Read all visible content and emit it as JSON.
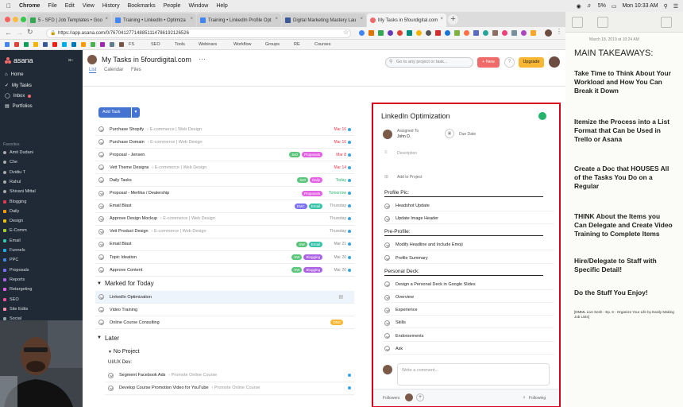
{
  "menubar": {
    "apple": "",
    "app": "Chrome",
    "items": [
      "File",
      "Edit",
      "View",
      "History",
      "Bookmarks",
      "People",
      "Window",
      "Help"
    ],
    "right": [
      "5%",
      "Mon 10:33 AM"
    ]
  },
  "tabs": [
    {
      "label": "5 - SFD | Job Templates • Goo",
      "color": "#34a853"
    },
    {
      "label": "Training • LinkedIn • Optimiza",
      "color": "#4285f4"
    },
    {
      "label": "Training • LinkedIn Profile Opt",
      "color": "#4285f4"
    },
    {
      "label": "Digital Marketing Mastery Lau",
      "color": "#3b5998"
    },
    {
      "label": "My Tasks in 5fourdigital.com",
      "color": "#f06a6a"
    }
  ],
  "address": {
    "url": "https://app.asana.com/0/767041277148851114786192126526"
  },
  "bookmarks": [
    "FS",
    "SEO",
    "Tools",
    "Webinars",
    "Workflow",
    "Groups",
    "RE",
    "Courses"
  ],
  "sidebar": {
    "logo": "asana",
    "nav": [
      {
        "label": "Home"
      },
      {
        "label": "My Tasks"
      },
      {
        "label": "Inbox"
      },
      {
        "label": "Portfolios"
      }
    ],
    "favorites_label": "Favorites",
    "favorites": [
      {
        "label": "Amit Dudani",
        "color": "#aaa"
      },
      {
        "label": "Che",
        "color": "#aaa"
      },
      {
        "label": "Dvidiu T",
        "color": "#aaa"
      },
      {
        "label": "Rahul",
        "color": "#aaa"
      },
      {
        "label": "Shivani Mittal",
        "color": "#aaa"
      },
      {
        "label": "Blogging",
        "color": "#e8384f"
      },
      {
        "label": "Daily",
        "color": "#fd9a00"
      },
      {
        "label": "Design",
        "color": "#eec300"
      },
      {
        "label": "E-Comm",
        "color": "#a4cf30"
      },
      {
        "label": "Email",
        "color": "#37c5ab"
      },
      {
        "label": "Funnels",
        "color": "#20aaea"
      },
      {
        "label": "PPC",
        "color": "#4186e0"
      },
      {
        "label": "Proposals",
        "color": "#7a6ff0"
      },
      {
        "label": "Reports",
        "color": "#aa62e3"
      },
      {
        "label": "Retargeting",
        "color": "#e362e3"
      },
      {
        "label": "SEO",
        "color": "#ea4e9d"
      },
      {
        "label": "Site Edits",
        "color": "#fc91ad"
      },
      {
        "label": "Social",
        "color": "#8da3a6"
      },
      {
        "label": "Web Dev",
        "color": "#fd9a00"
      }
    ]
  },
  "header": {
    "title": "My Tasks in 5fourdigital.com",
    "more": "···",
    "tabs": [
      "List",
      "Calendar",
      "Files"
    ],
    "search_placeholder": "Go to any project or task...",
    "new_label": "+ New",
    "help": "?",
    "upgrade": "Upgrade"
  },
  "list": {
    "add_task": "Add Task",
    "tasks": [
      {
        "name": "Purchase Shopify",
        "project": "‹ E-commerce | Web Design",
        "tags": [],
        "date": "Mar 16",
        "date_style": "red"
      },
      {
        "name": "Purchase Domain",
        "project": "‹ E-commerce | Web Design",
        "tags": [],
        "date": "Mar 16",
        "date_style": "red"
      },
      {
        "name": "Proposal - Jensen",
        "project": "",
        "tags": [
          {
            "t": "540",
            "c": "#5bc67b"
          },
          {
            "t": "Proposals",
            "c": "#e362e3"
          }
        ],
        "date": "Mar 8",
        "date_style": "red"
      },
      {
        "name": "Vett Theme Designs",
        "project": "‹ E-commerce | Web Design",
        "tags": [],
        "date": "Mar 14",
        "date_style": "red"
      },
      {
        "name": "Daily Tasks",
        "project": "",
        "tags": [
          {
            "t": "540",
            "c": "#5bc67b"
          },
          {
            "t": "Daily",
            "c": "#e362e3"
          }
        ],
        "date": "Today",
        "date_style": "green"
      },
      {
        "name": "Proposal - Merlika / Dealership",
        "project": "",
        "tags": [
          {
            "t": "Proposals",
            "c": "#e362e3"
          }
        ],
        "date": "Tomorrow",
        "date_style": "green"
      },
      {
        "name": "Email Blast",
        "project": "",
        "tags": [
          {
            "t": "EMC",
            "c": "#7a6ff0"
          },
          {
            "t": "Email",
            "c": "#37c5ab"
          }
        ],
        "date": "Thursday",
        "date_style": ""
      },
      {
        "name": "Approve Design Mockup",
        "project": "‹ E-commerce | Web Design",
        "tags": [],
        "date": "Thursday",
        "date_style": ""
      },
      {
        "name": "Vett Product Design",
        "project": "‹ E-commerce | Web Design",
        "tags": [],
        "date": "Thursday",
        "date_style": ""
      },
      {
        "name": "Email Blast",
        "project": "",
        "tags": [
          {
            "t": "SW",
            "c": "#5bc67b"
          },
          {
            "t": "Email",
            "c": "#37c5ab"
          }
        ],
        "date": "Mar 21",
        "date_style": ""
      },
      {
        "name": "Topic Ideation",
        "project": "",
        "tags": [
          {
            "t": "SW",
            "c": "#5bc67b"
          },
          {
            "t": "Blogging",
            "c": "#aa62e3"
          }
        ],
        "date": "Mar 20",
        "date_style": ""
      },
      {
        "name": "Approve Content",
        "project": "",
        "tags": [
          {
            "t": "SW",
            "c": "#5bc67b"
          },
          {
            "t": "Blogging",
            "c": "#aa62e3"
          }
        ],
        "date": "Mar 20",
        "date_style": ""
      }
    ],
    "marked_label": "Marked for Today",
    "marked": [
      {
        "name": "LinkedIn Optimization",
        "highlight": true
      },
      {
        "name": "Video Training",
        "highlight": false
      },
      {
        "name": "Online Course Consulting",
        "highlight": false,
        "tag": {
          "t": "DNS",
          "c": "#f8b632"
        }
      }
    ],
    "later_label": "Later",
    "no_project_label": "No Project",
    "uiux_label": "UI/UX Dev:",
    "later": [
      {
        "name": "Segment Facebook Ads",
        "project": "‹ Promote Online Course"
      },
      {
        "name": "Develop Course Promotion Video for YouTube",
        "project": "‹ Promote Online Course"
      }
    ]
  },
  "detail": {
    "title": "LinkedIn Optimization",
    "assigned_label": "Assigned To",
    "assignee": "John D.",
    "due_label": "Due Date",
    "description_label": "Description",
    "add_project": "Add to Project",
    "sections": [
      {
        "heading": "Profile Pic:",
        "items": [
          "Headshot Update",
          "Update Image Header"
        ]
      },
      {
        "heading": "Pre-Profile:",
        "items": [
          "Modify Headline and Include Emoji",
          "Profile Summary"
        ]
      },
      {
        "heading": "Personal Deck:",
        "items": [
          "Design a Personal Deck in Google Slides",
          "Overview",
          "Experience",
          "Skills",
          "Endorsements",
          "Ask"
        ]
      }
    ],
    "comment_placeholder": "Write a comment...",
    "followers_label": "Followers",
    "following_label": "Following"
  },
  "notes": {
    "date": "March 18, 2019 at 10:24 AM",
    "title": "MAIN TAKEAWAYS:",
    "points": [
      "Take Time to Think About Your Workload and How You Can Break it Down",
      "Itemize the Process into a List Format that Can be Used in Trello or Asana",
      "Create a Doc that HOUSES All of the Tasks You Do on a Regular",
      "THINK About the Items you Can Delegate and Create Video Training to Complete Items",
      "Hire/Delegate to Staff with Specific Detail!",
      "Do the Stuff You Enjoy!"
    ],
    "small": "[DMML Live Sesh - Ep. 6 - Organize Your Life by Easily Making Job Lists]"
  }
}
